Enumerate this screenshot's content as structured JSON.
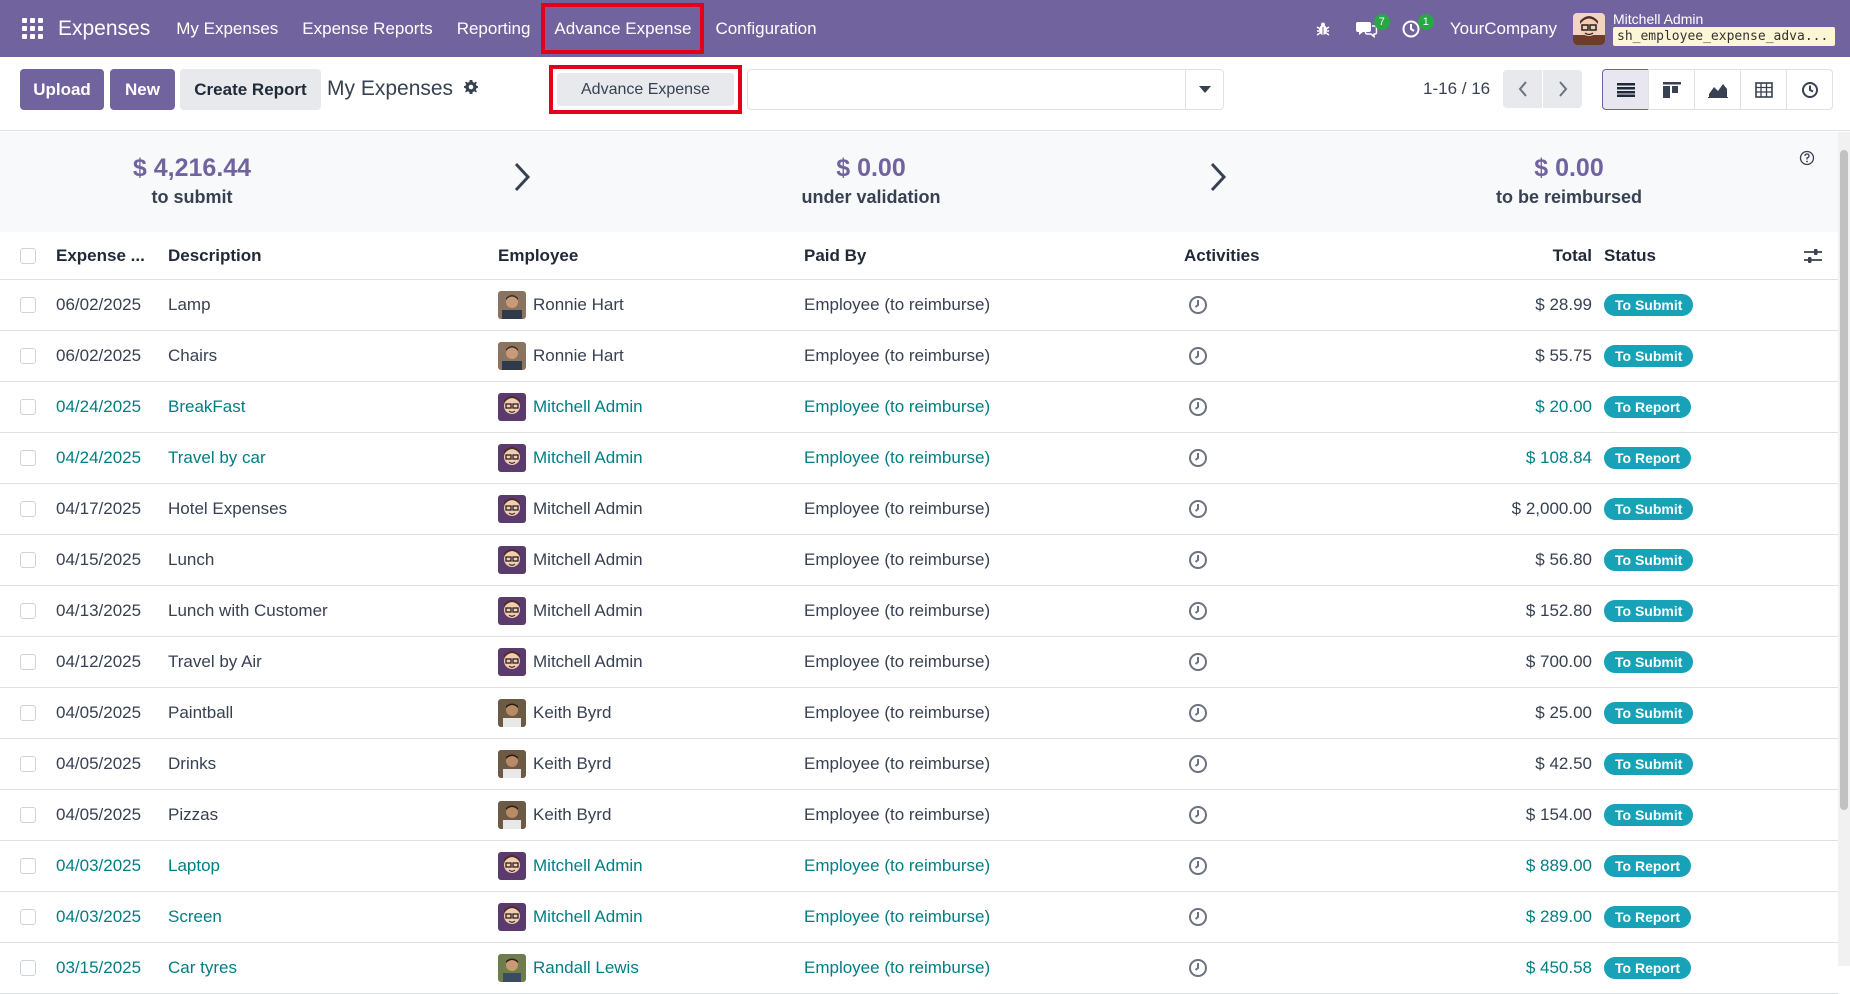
{
  "navbar": {
    "app_name": "Expenses",
    "menu": [
      "My Expenses",
      "Expense Reports",
      "Reporting",
      "Advance Expense",
      "Configuration"
    ],
    "chat_badge": "7",
    "activity_badge": "1",
    "company": "YourCompany",
    "user_name": "Mitchell Admin",
    "db_name": "sh_employee_expense_adva..."
  },
  "control": {
    "upload_label": "Upload",
    "new_label": "New",
    "create_report_label": "Create Report",
    "breadcrumb": "My Expenses",
    "advance_expense_label": "Advance Expense",
    "search_placeholder": "",
    "pager": "1-16 / 16"
  },
  "dashboard": {
    "to_submit_amount": "$ 4,216.44",
    "to_submit_label": "to submit",
    "under_validation_amount": "$ 0.00",
    "under_validation_label": "under validation",
    "reimbursed_amount": "$ 0.00",
    "reimbursed_label": "to be reimbursed"
  },
  "table": {
    "headers": {
      "date": "Expense ...",
      "description": "Description",
      "employee": "Employee",
      "paid_by": "Paid By",
      "activities": "Activities",
      "total": "Total",
      "status": "Status"
    },
    "rows": [
      {
        "date": "06/02/2025",
        "description": "Lamp",
        "employee": "Ronnie Hart",
        "avatar": "ronnie",
        "paid_by": "Employee (to reimburse)",
        "total": "$ 28.99",
        "status": "To Submit",
        "link": false
      },
      {
        "date": "06/02/2025",
        "description": "Chairs",
        "employee": "Ronnie Hart",
        "avatar": "ronnie",
        "paid_by": "Employee (to reimburse)",
        "total": "$ 55.75",
        "status": "To Submit",
        "link": false
      },
      {
        "date": "04/24/2025",
        "description": "BreakFast",
        "employee": "Mitchell Admin",
        "avatar": "mitchell",
        "paid_by": "Employee (to reimburse)",
        "total": "$ 20.00",
        "status": "To Report",
        "link": true
      },
      {
        "date": "04/24/2025",
        "description": "Travel by car",
        "employee": "Mitchell Admin",
        "avatar": "mitchell",
        "paid_by": "Employee (to reimburse)",
        "total": "$ 108.84",
        "status": "To Report",
        "link": true
      },
      {
        "date": "04/17/2025",
        "description": "Hotel Expenses",
        "employee": "Mitchell Admin",
        "avatar": "mitchell",
        "paid_by": "Employee (to reimburse)",
        "total": "$ 2,000.00",
        "status": "To Submit",
        "link": false
      },
      {
        "date": "04/15/2025",
        "description": "Lunch",
        "employee": "Mitchell Admin",
        "avatar": "mitchell",
        "paid_by": "Employee (to reimburse)",
        "total": "$ 56.80",
        "status": "To Submit",
        "link": false
      },
      {
        "date": "04/13/2025",
        "description": "Lunch with Customer",
        "employee": "Mitchell Admin",
        "avatar": "mitchell",
        "paid_by": "Employee (to reimburse)",
        "total": "$ 152.80",
        "status": "To Submit",
        "link": false
      },
      {
        "date": "04/12/2025",
        "description": "Travel by Air",
        "employee": "Mitchell Admin",
        "avatar": "mitchell",
        "paid_by": "Employee (to reimburse)",
        "total": "$ 700.00",
        "status": "To Submit",
        "link": false
      },
      {
        "date": "04/05/2025",
        "description": "Paintball",
        "employee": "Keith Byrd",
        "avatar": "keith",
        "paid_by": "Employee (to reimburse)",
        "total": "$ 25.00",
        "status": "To Submit",
        "link": false
      },
      {
        "date": "04/05/2025",
        "description": "Drinks",
        "employee": "Keith Byrd",
        "avatar": "keith",
        "paid_by": "Employee (to reimburse)",
        "total": "$ 42.50",
        "status": "To Submit",
        "link": false
      },
      {
        "date": "04/05/2025",
        "description": "Pizzas",
        "employee": "Keith Byrd",
        "avatar": "keith",
        "paid_by": "Employee (to reimburse)",
        "total": "$ 154.00",
        "status": "To Submit",
        "link": false
      },
      {
        "date": "04/03/2025",
        "description": "Laptop",
        "employee": "Mitchell Admin",
        "avatar": "mitchell",
        "paid_by": "Employee (to reimburse)",
        "total": "$ 889.00",
        "status": "To Report",
        "link": true
      },
      {
        "date": "04/03/2025",
        "description": "Screen",
        "employee": "Mitchell Admin",
        "avatar": "mitchell",
        "paid_by": "Employee (to reimburse)",
        "total": "$ 289.00",
        "status": "To Report",
        "link": true
      },
      {
        "date": "03/15/2025",
        "description": "Car tyres",
        "employee": "Randall Lewis",
        "avatar": "randall",
        "paid_by": "Employee (to reimburse)",
        "total": "$ 450.58",
        "status": "To Report",
        "link": true
      }
    ]
  },
  "colors": {
    "brand": "#71639e",
    "link": "#017e84",
    "status_badge": "#17a2b8",
    "highlight": "#e3001b"
  }
}
